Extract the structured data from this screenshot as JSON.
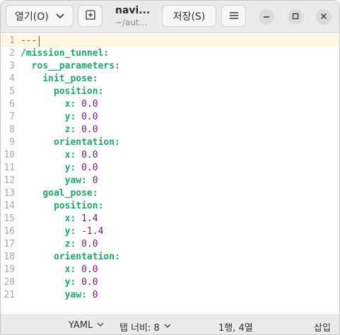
{
  "header": {
    "open_label": "열기(O)",
    "title": "navi...",
    "subtitle": "~/aut...",
    "save_label": "저장(S)",
    "icons": {
      "open_dropdown": "chevron-down-icon",
      "new_tab": "new-tab-icon",
      "menu": "hamburger-menu-icon",
      "minimize": "minimize-icon",
      "maximize": "maximize-icon",
      "close": "close-icon"
    }
  },
  "editor": {
    "colors": {
      "key": "#26a269",
      "value": "#6a1f7a",
      "line_number": "#a8a8a8",
      "document_marker": "#c64600"
    },
    "lines": [
      {
        "n": "1",
        "indent": "",
        "key": "",
        "sep": "",
        "value": "---"
      },
      {
        "n": "2",
        "indent": "",
        "key": "/mission_tunnel",
        "sep": ":",
        "value": ""
      },
      {
        "n": "3",
        "indent": "  ",
        "key": "ros__parameters",
        "sep": ":",
        "value": ""
      },
      {
        "n": "4",
        "indent": "    ",
        "key": "init_pose",
        "sep": ":",
        "value": ""
      },
      {
        "n": "5",
        "indent": "      ",
        "key": "position",
        "sep": ":",
        "value": ""
      },
      {
        "n": "6",
        "indent": "        ",
        "key": "x",
        "sep": ":",
        "value": " 0.0"
      },
      {
        "n": "7",
        "indent": "        ",
        "key": "y",
        "sep": ":",
        "value": " 0.0"
      },
      {
        "n": "8",
        "indent": "        ",
        "key": "z",
        "sep": ":",
        "value": " 0.0"
      },
      {
        "n": "9",
        "indent": "      ",
        "key": "orientation",
        "sep": ":",
        "value": ""
      },
      {
        "n": "10",
        "indent": "        ",
        "key": "x",
        "sep": ":",
        "value": " 0.0"
      },
      {
        "n": "11",
        "indent": "        ",
        "key": "y",
        "sep": ":",
        "value": " 0.0"
      },
      {
        "n": "12",
        "indent": "        ",
        "key": "yaw",
        "sep": ":",
        "value": " 0"
      },
      {
        "n": "13",
        "indent": "    ",
        "key": "goal_pose",
        "sep": ":",
        "value": ""
      },
      {
        "n": "14",
        "indent": "      ",
        "key": "position",
        "sep": ":",
        "value": ""
      },
      {
        "n": "15",
        "indent": "        ",
        "key": "x",
        "sep": ":",
        "value": " 1.4"
      },
      {
        "n": "16",
        "indent": "        ",
        "key": "y",
        "sep": ":",
        "value": " -1.4"
      },
      {
        "n": "17",
        "indent": "        ",
        "key": "z",
        "sep": ":",
        "value": " 0.0"
      },
      {
        "n": "18",
        "indent": "      ",
        "key": "orientation",
        "sep": ":",
        "value": ""
      },
      {
        "n": "19",
        "indent": "        ",
        "key": "x",
        "sep": ":",
        "value": " 0.0"
      },
      {
        "n": "20",
        "indent": "        ",
        "key": "y",
        "sep": ":",
        "value": " 0.0"
      },
      {
        "n": "21",
        "indent": "        ",
        "key": "yaw",
        "sep": ":",
        "value": " 0"
      }
    ]
  },
  "statusbar": {
    "language": "YAML",
    "tab_width": "탭 너비: 8",
    "cursor_position": "1행, 4열",
    "insert_mode": "삽입"
  }
}
